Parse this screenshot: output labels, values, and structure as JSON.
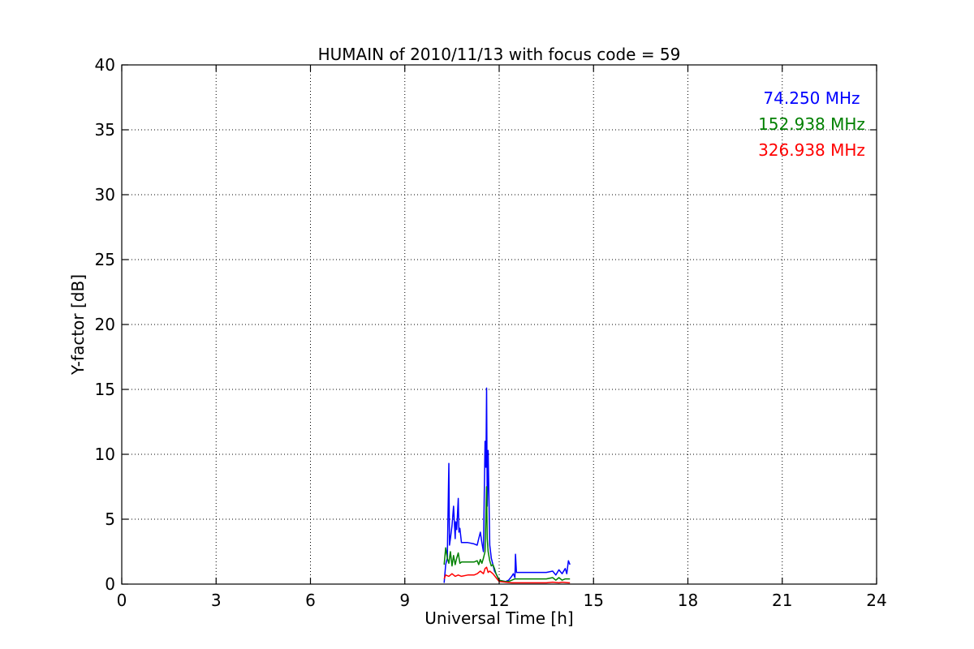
{
  "chart_data": {
    "type": "line",
    "title": "HUMAIN of 2010/11/13 with focus code = 59",
    "xlabel": "Universal Time [h]",
    "ylabel": "Y-factor [dB]",
    "xlim": [
      0,
      24
    ],
    "ylim": [
      0,
      40
    ],
    "xticks": [
      0,
      3,
      6,
      9,
      12,
      15,
      18,
      21,
      24
    ],
    "yticks": [
      0,
      5,
      10,
      15,
      20,
      25,
      30,
      35,
      40
    ],
    "grid": true,
    "legend_position": "top-right",
    "series": [
      {
        "name": "74.250 MHz",
        "color": "#0000ff",
        "x": [
          10.25,
          10.3,
          10.35,
          10.4,
          10.42,
          10.45,
          10.5,
          10.55,
          10.6,
          10.62,
          10.65,
          10.7,
          10.72,
          10.75,
          10.8,
          11.0,
          11.2,
          11.3,
          11.35,
          11.4,
          11.45,
          11.5,
          11.55,
          11.58,
          11.6,
          11.62,
          11.65,
          11.7,
          11.75,
          11.8,
          11.85,
          11.9,
          12.0,
          12.2,
          12.3,
          12.4,
          12.45,
          12.5,
          12.52,
          12.55,
          13.0,
          13.5,
          13.7,
          13.8,
          13.9,
          14.0,
          14.1,
          14.15,
          14.2,
          14.25
        ],
        "y": [
          0.1,
          1.5,
          2.0,
          9.3,
          3.0,
          3.5,
          4.5,
          6.0,
          3.5,
          4.8,
          4.2,
          6.6,
          4.0,
          4.3,
          3.2,
          3.2,
          3.1,
          3.0,
          3.5,
          4.0,
          3.2,
          2.5,
          11.0,
          9.0,
          15.1,
          6.0,
          10.3,
          3.0,
          2.0,
          1.5,
          1.0,
          0.8,
          0.3,
          0.2,
          0.3,
          0.6,
          0.8,
          0.5,
          2.3,
          0.9,
          0.9,
          0.9,
          1.0,
          0.7,
          1.1,
          0.8,
          1.2,
          0.8,
          1.8,
          1.5
        ]
      },
      {
        "name": "152.938 MHz",
        "color": "#008000",
        "x": [
          10.25,
          10.3,
          10.35,
          10.4,
          10.45,
          10.5,
          10.55,
          10.6,
          10.65,
          10.7,
          10.75,
          10.8,
          11.0,
          11.2,
          11.3,
          11.35,
          11.4,
          11.45,
          11.5,
          11.55,
          11.6,
          11.62,
          11.65,
          11.7,
          11.75,
          11.8,
          11.85,
          11.9,
          12.0,
          12.2,
          12.3,
          12.4,
          12.5,
          13.0,
          13.5,
          13.7,
          13.8,
          13.9,
          14.0,
          14.1,
          14.2,
          14.25
        ],
        "y": [
          1.5,
          2.8,
          2.0,
          1.6,
          2.5,
          1.4,
          2.2,
          1.5,
          2.0,
          2.4,
          1.6,
          1.7,
          1.7,
          1.7,
          1.8,
          1.5,
          1.9,
          1.6,
          2.0,
          2.5,
          7.5,
          3.5,
          2.5,
          1.8,
          1.4,
          1.5,
          1.2,
          0.8,
          0.3,
          0.2,
          0.2,
          0.3,
          0.4,
          0.4,
          0.4,
          0.5,
          0.3,
          0.5,
          0.3,
          0.4,
          0.4,
          0.4
        ]
      },
      {
        "name": "326.938 MHz",
        "color": "#ff0000",
        "x": [
          10.25,
          10.3,
          10.4,
          10.5,
          10.6,
          10.7,
          10.8,
          11.0,
          11.2,
          11.3,
          11.4,
          11.5,
          11.55,
          11.6,
          11.65,
          11.7,
          11.8,
          11.9,
          12.0,
          12.2,
          12.4,
          12.5,
          13.0,
          13.5,
          13.7,
          13.9,
          14.0,
          14.2,
          14.25
        ],
        "y": [
          0.4,
          0.7,
          0.6,
          0.8,
          0.6,
          0.7,
          0.6,
          0.7,
          0.7,
          0.8,
          1.0,
          0.8,
          1.2,
          1.3,
          0.9,
          1.0,
          0.8,
          0.5,
          0.2,
          0.15,
          0.1,
          0.1,
          0.1,
          0.1,
          0.15,
          0.1,
          0.15,
          0.1,
          0.1
        ]
      }
    ]
  }
}
